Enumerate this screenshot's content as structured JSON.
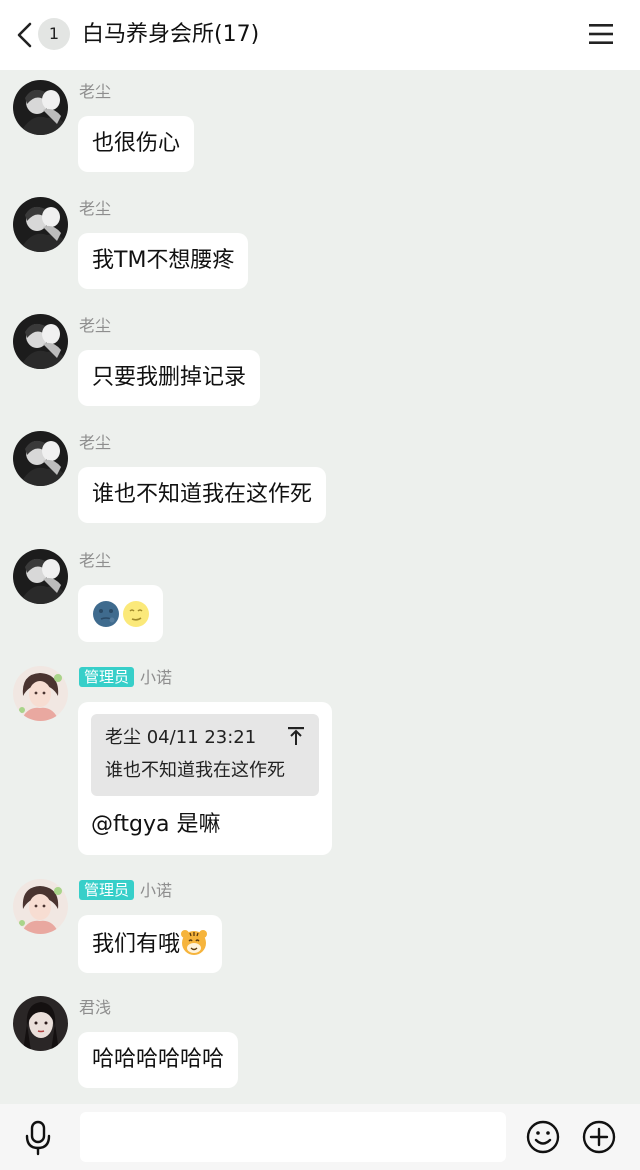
{
  "header": {
    "unread_count": "1",
    "title": "白马养身会所(17)"
  },
  "messages": [
    {
      "sender": "老尘",
      "text": "也很伤心"
    },
    {
      "sender": "老尘",
      "text": "我TM不想腰疼"
    },
    {
      "sender": "老尘",
      "text": "只要我删掉记录"
    },
    {
      "sender": "老尘",
      "text": "谁也不知道我在这作死"
    },
    {
      "sender": "老尘",
      "emojis": [
        "dark-moon-face-emoji",
        "crescent-moon-face-emoji"
      ]
    },
    {
      "sender": "小诺",
      "role": "管理员",
      "quote": {
        "header": "老尘 04/11 23:21",
        "text": "谁也不知道我在这作死"
      },
      "text": "@ftgya 是嘛"
    },
    {
      "sender": "小诺",
      "role": "管理员",
      "text": "我们有哦",
      "emoji": "tiger-face-emoji"
    },
    {
      "sender": "君浅",
      "text": "哈哈哈哈哈哈"
    }
  ],
  "input": {
    "placeholder": ""
  },
  "colors": {
    "background": "#edf0ed",
    "bubble": "#ffffff",
    "admin_badge": "#37cfc9",
    "sender_name": "#8e8e8e"
  }
}
